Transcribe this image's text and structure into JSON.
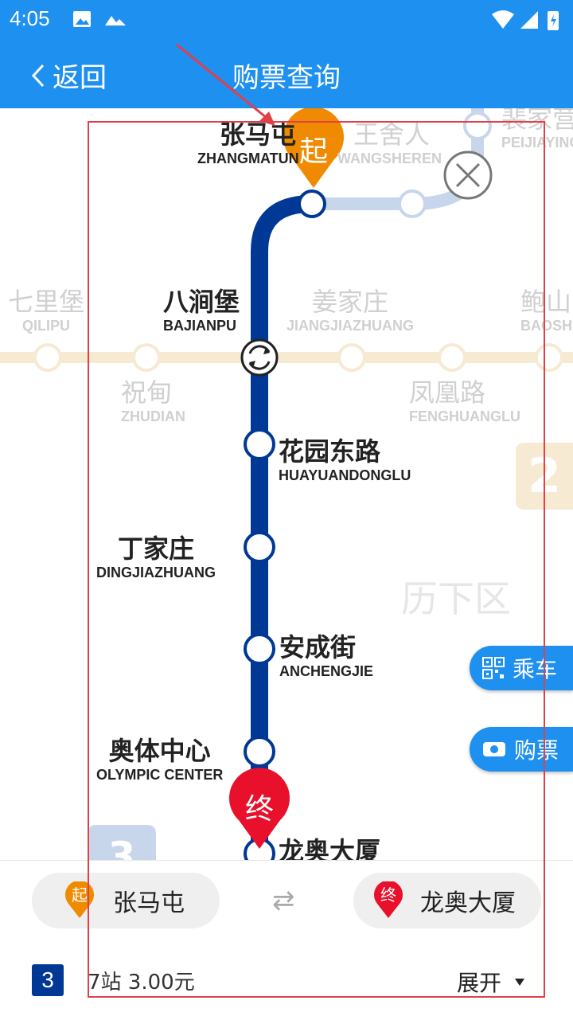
{
  "status": {
    "time": "4:05"
  },
  "appbar": {
    "back_label": "返回",
    "title": "购票查询"
  },
  "map": {
    "district": "历下区",
    "corner_badge_2": "2",
    "corner_badge_3": "3",
    "route_stations": [
      {
        "cn": "张马屯",
        "en": "ZHANGMATUN"
      },
      {
        "cn": "八涧堡",
        "en": "BAJIANPU"
      },
      {
        "cn": "花园东路",
        "en": "HUAYUANDONGLU"
      },
      {
        "cn": "丁家庄",
        "en": "DINGJIAZHUANG"
      },
      {
        "cn": "安成街",
        "en": "ANCHENGJIE"
      },
      {
        "cn": "奥体中心",
        "en": "OLYMPIC CENTER"
      },
      {
        "cn": "龙奥大厦",
        "en": ""
      }
    ],
    "other_stations": [
      {
        "cn": "王舍人",
        "en": "WANGSHEREN"
      },
      {
        "cn": "裴家营",
        "en": "PEIJIAYING"
      },
      {
        "cn": "七里堡",
        "en": "QILIPU"
      },
      {
        "cn": "姜家庄",
        "en": "JIANGJIAZHUANG"
      },
      {
        "cn": "鲍山",
        "en": "BAOSHAN"
      },
      {
        "cn": "祝甸",
        "en": "ZHUDIAN"
      },
      {
        "cn": "凤凰路",
        "en": "FENGHUANGLU"
      }
    ],
    "start_marker": "起",
    "end_marker": "终",
    "colors": {
      "line3": "#003896",
      "line_faded": "#c8d6ec",
      "line2_faded": "#f6ead2",
      "start": "#f08a00",
      "end": "#e8102a",
      "accent": "#1e90f0"
    }
  },
  "float_buttons": {
    "ride": "乘车",
    "buy": "购票"
  },
  "bottom": {
    "from_marker": "起",
    "from": "张马屯",
    "to_marker": "终",
    "to": "龙奥大厦",
    "line_number": "3",
    "stats": "7站  3.00元",
    "expand_label": "展开"
  }
}
